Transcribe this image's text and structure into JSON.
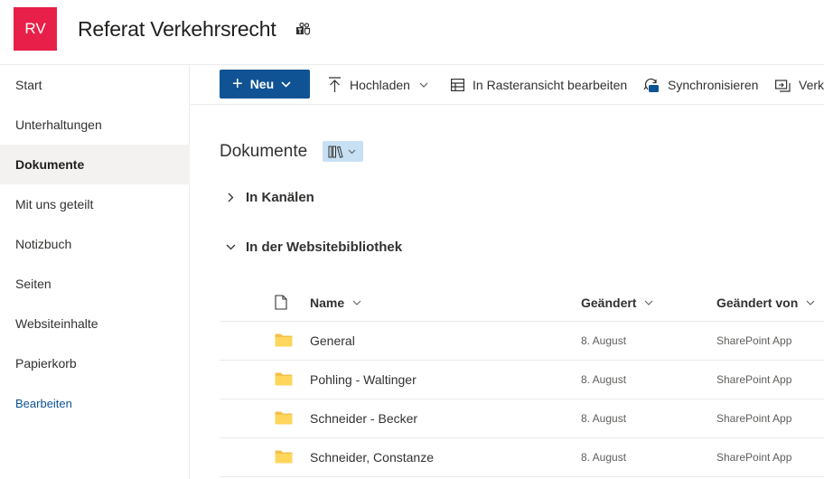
{
  "site": {
    "logo_text": "RV",
    "logo_color": "#e81f48",
    "title": "Referat Verkehrsrecht",
    "title_icon": "teams-icon"
  },
  "nav": {
    "items": [
      {
        "label": "Start",
        "active": false
      },
      {
        "label": "Unterhaltungen",
        "active": false
      },
      {
        "label": "Dokumente",
        "active": true
      },
      {
        "label": "Mit uns geteilt",
        "active": false
      },
      {
        "label": "Notizbuch",
        "active": false
      },
      {
        "label": "Seiten",
        "active": false
      },
      {
        "label": "Websiteinhalte",
        "active": false
      },
      {
        "label": "Papierkorb",
        "active": false
      }
    ],
    "edit_label": "Bearbeiten"
  },
  "command_bar": {
    "new_label": "Neu",
    "upload_label": "Hochladen",
    "grid_edit_label": "In Rasteransicht bearbeiten",
    "sync_label": "Synchronisieren",
    "shortcut_label": "Verkn",
    "accent_color": "#0f5394"
  },
  "library": {
    "title": "Dokumente",
    "sections": [
      {
        "label": "In Kanälen",
        "expanded": false
      },
      {
        "label": "In der Websitebibliothek",
        "expanded": true
      }
    ],
    "columns": {
      "name": "Name",
      "modified": "Geändert",
      "modified_by": "Geändert von"
    },
    "rows": [
      {
        "name": "General",
        "modified": "8. August",
        "modified_by": "SharePoint App"
      },
      {
        "name": "Pohling - Waltinger",
        "modified": "8. August",
        "modified_by": "SharePoint App"
      },
      {
        "name": "Schneider - Becker",
        "modified": "8. August",
        "modified_by": "SharePoint App"
      },
      {
        "name": "Schneider, Constanze",
        "modified": "8. August",
        "modified_by": "SharePoint App"
      }
    ]
  }
}
